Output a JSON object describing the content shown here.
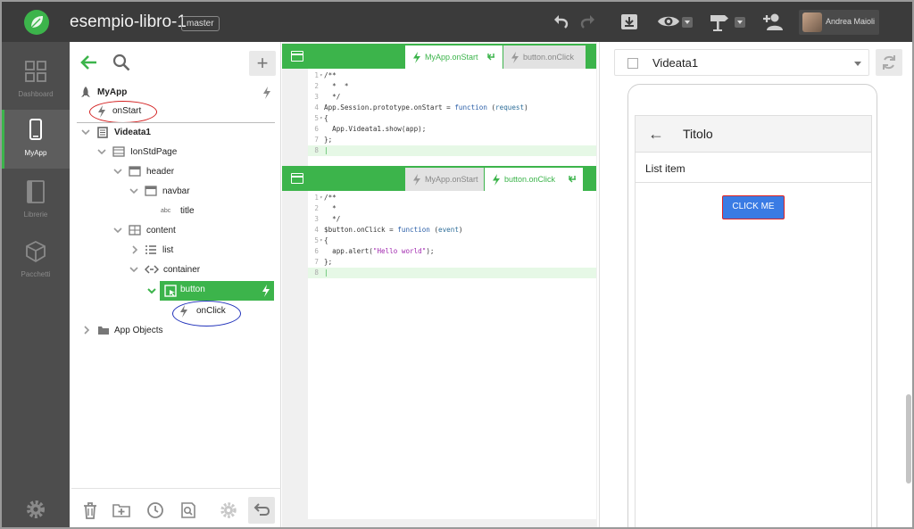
{
  "app": {
    "title": "esempio-libro-1",
    "branch": "master",
    "user": "Andrea Maioli",
    "accent": "#3cb44b",
    "topbar_icons": [
      "undo-icon",
      "redo-icon",
      "download-icon",
      "eye-icon",
      "signpost-icon",
      "add-user-icon"
    ]
  },
  "leftnav": {
    "items": [
      {
        "label": "Dashboard",
        "icon": "dashboard-icon"
      },
      {
        "label": "MyApp",
        "icon": "mobile-icon"
      },
      {
        "label": "Librerie",
        "icon": "library-icon"
      },
      {
        "label": "Pacchetti",
        "icon": "package-icon"
      }
    ],
    "settings_icon": "gear-icon"
  },
  "tree": {
    "add_label": "+",
    "nodes": {
      "myapp": "MyApp",
      "onstart": "onStart",
      "videata1": "Videata1",
      "ionstdpage": "IonStdPage",
      "header": "header",
      "navbar": "navbar",
      "abc": "abc",
      "title": "title",
      "content": "content",
      "list": "list",
      "container": "container",
      "button": "button",
      "onclick": "onClick",
      "app_objects": "App Objects"
    },
    "footer_icons": [
      "trash-icon",
      "add-folder-icon",
      "history-icon",
      "inspect-icon",
      "gear-icon",
      "undo-icon"
    ]
  },
  "editor_top": {
    "tabs": [
      {
        "label": "MyApp.onStart",
        "state": "active"
      },
      {
        "label": "button.onClick",
        "state": "inactive"
      }
    ]
  },
  "editor_bottom": {
    "tabs": [
      {
        "label": "MyApp.onStart",
        "state": "inactive"
      },
      {
        "label": "button.onClick",
        "state": "active"
      }
    ]
  },
  "preview": {
    "screen": "Videata1",
    "header_title": "Titolo",
    "back_glyph": "←",
    "list_item": "List item",
    "button_label": "CLICK ME"
  }
}
